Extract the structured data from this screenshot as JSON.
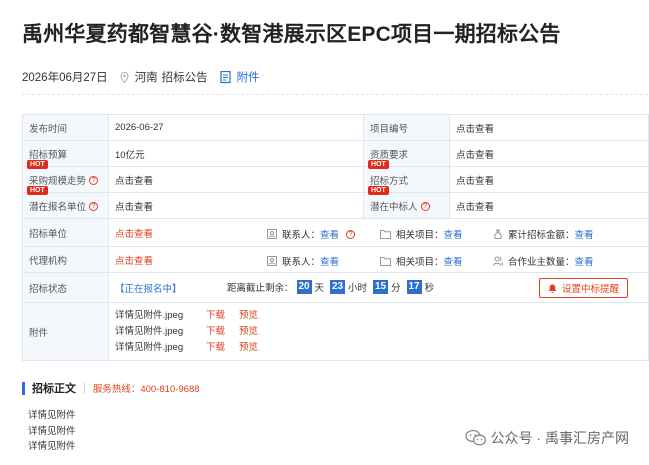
{
  "title": "禹州华夏药都智慧谷·数智港展示区EPC项目一期招标公告",
  "meta": {
    "date": "2026年06月27日",
    "location": "河南",
    "category": "招标公告",
    "attachment_label": "附件"
  },
  "info": {
    "publish_time_label": "发布时间",
    "publish_time": "2026-06-27",
    "project_no_label": "项目编号",
    "project_no": "点击查看",
    "budget_label": "招标预算",
    "budget": "10亿元",
    "qualification_label": "资质要求",
    "qualification": "点击查看",
    "scale_label": "采购规模走势",
    "scale_value": "点击查看",
    "method_label": "招标方式",
    "method_value": "点击查看",
    "potential_bidder_label": "潜在报名单位",
    "potential_bidder_value": "点击查看",
    "potential_winner_label": "潜在中标人",
    "potential_winner_value": "点击查看",
    "hot": "HOT",
    "q": "?",
    "tender_unit_label": "招标单位",
    "tender_unit_value": "点击查看",
    "contact_label": "联系人：",
    "view": "查看",
    "related_label": "相关项目：",
    "cumulative_label": "累计招标金额：",
    "agent_label": "代理机构",
    "agent_value": "点击查看",
    "partner_label": "合作业主数量：",
    "status_label": "招标状态",
    "status_value": "【正在报名中】",
    "deadline_label": "距离截止剩余：",
    "days": "20",
    "days_unit": "天",
    "hours": "23",
    "hours_unit": "小时",
    "minutes": "15",
    "minutes_unit": "分",
    "seconds": "17",
    "seconds_unit": "秒",
    "remind_button": "设置中标提醒",
    "attachment_label": "附件",
    "attachments": [
      {
        "name": "详情见附件.jpeg",
        "download": "下载",
        "preview": "预览"
      },
      {
        "name": "详情见附件.jpeg",
        "download": "下载",
        "preview": "预览"
      },
      {
        "name": "详情见附件.jpeg",
        "download": "下载",
        "preview": "预览"
      }
    ]
  },
  "section": {
    "title": "招标正文",
    "hotline": "服务热线：400-810-9688"
  },
  "body_lines": [
    "详情见附件",
    "详情见附件",
    "详情见附件"
  ],
  "watermark": "公众号 · 禹事汇房产网",
  "colors": {
    "accent": "#2a6fd1",
    "red": "#e0421d",
    "label_bg": "#f4f8fc",
    "border": "#dfe6ee"
  }
}
